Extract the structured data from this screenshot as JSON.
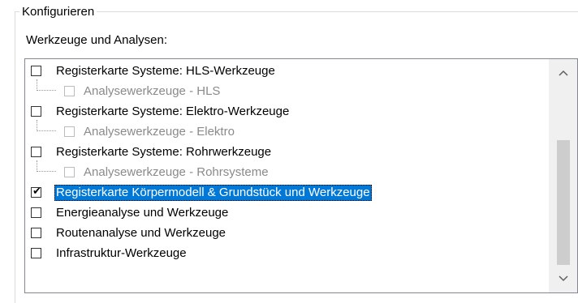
{
  "group": {
    "title": "Konfigurieren"
  },
  "section": {
    "label": "Werkzeuge und Analysen:"
  },
  "items": [
    {
      "label": "Registerkarte Systeme: HLS-Werkzeuge",
      "checked": false,
      "level": 0,
      "enabled": true,
      "selected": false
    },
    {
      "label": "Analysewerkzeuge - HLS",
      "checked": false,
      "level": 1,
      "enabled": false,
      "selected": false
    },
    {
      "label": "Registerkarte Systeme: Elektro-Werkzeuge",
      "checked": false,
      "level": 0,
      "enabled": true,
      "selected": false
    },
    {
      "label": "Analysewerkzeuge - Elektro",
      "checked": false,
      "level": 1,
      "enabled": false,
      "selected": false
    },
    {
      "label": "Registerkarte Systeme: Rohrwerkzeuge",
      "checked": false,
      "level": 0,
      "enabled": true,
      "selected": false
    },
    {
      "label": "Analysewerkzeuge - Rohrsysteme",
      "checked": false,
      "level": 1,
      "enabled": false,
      "selected": false
    },
    {
      "label": "Registerkarte Körpermodell & Grundstück und Werkzeuge",
      "checked": true,
      "level": 0,
      "enabled": true,
      "selected": true
    },
    {
      "label": "Energieanalyse und Werkzeuge",
      "checked": false,
      "level": 0,
      "enabled": true,
      "selected": false
    },
    {
      "label": "Routenanalyse und Werkzeuge",
      "checked": false,
      "level": 0,
      "enabled": true,
      "selected": false
    },
    {
      "label": "Infrastruktur-Werkzeuge",
      "checked": false,
      "level": 0,
      "enabled": true,
      "selected": false
    }
  ],
  "scrollbar": {
    "up_icon": "chevron-up-icon",
    "down_icon": "chevron-down-icon"
  },
  "colors": {
    "selection": "#0078d7",
    "disabled_text": "#8a8a8a",
    "border": "#828790"
  }
}
